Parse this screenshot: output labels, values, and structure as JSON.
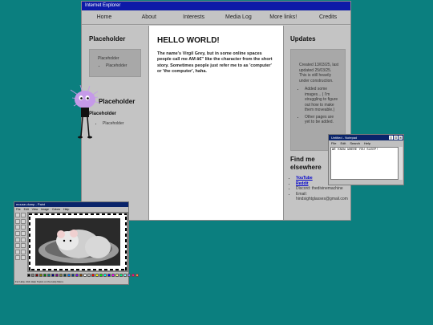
{
  "browser": {
    "title": "Internet Explorer"
  },
  "nav": [
    "Home",
    "About",
    "Interests",
    "Media Log",
    "More links!",
    "Credits"
  ],
  "left": {
    "heading": "Placeholder",
    "box_text": "Placeholder",
    "box_items": [
      "Placeholder"
    ],
    "heading2": "Placeholder",
    "sub": "Placeholder",
    "items": [
      "Placeholder"
    ]
  },
  "main": {
    "title": "HELLO WORLD!",
    "body": "The name's Virgil Grey, but in some online spaces people call me AM â€\" like the character from the short story. Sometimes people just refer me to as 'computer' or 'the computer', haha."
  },
  "right": {
    "heading": "Updates",
    "update_text": "Created 13/03/25, last updated 25/03/25. This is still heavily under construction.",
    "updates": [
      "Added some images... ( I'm struggling to figure out how to make them moveable.)",
      "Other pages are yet to be added."
    ],
    "elsewhere_heading": "Find me elsewhere",
    "links": [
      {
        "label": "YouTube",
        "link": true
      },
      {
        "label": "Reddit",
        "link": true
      },
      {
        "label": "Discord: thedivinemachine",
        "link": false
      },
      {
        "label": "Email: hindsightglasses@gmail.com",
        "link": false
      }
    ]
  },
  "notepad": {
    "title": "Untitled - Notepad",
    "menu": [
      "File",
      "Edit",
      "Search",
      "Help"
    ],
    "content": "WE KNOW WHERE YOU SLEEP!"
  },
  "paint": {
    "title": "mouse-dump - Paint",
    "menu": [
      "File",
      "Edit",
      "View",
      "Image",
      "Colors",
      "Help"
    ],
    "status": "For Help, click Help Topics on the Help Menu.",
    "palette": [
      "#000000",
      "#808080",
      "#800000",
      "#808000",
      "#008000",
      "#008080",
      "#000080",
      "#800080",
      "#808040",
      "#004040",
      "#0080ff",
      "#004080",
      "#8000ff",
      "#804000",
      "#ffffff",
      "#c0c0c0",
      "#ff0000",
      "#ffff00",
      "#00ff00",
      "#00ffff",
      "#0000ff",
      "#ff00ff",
      "#ffff80",
      "#00ff80",
      "#80ffff",
      "#8080ff",
      "#ff0080",
      "#ff8040"
    ]
  },
  "colors": {
    "teal_bg": "#0b7f7f",
    "title_blue": "#0d1aa8",
    "mascot": "#c59ae8"
  }
}
